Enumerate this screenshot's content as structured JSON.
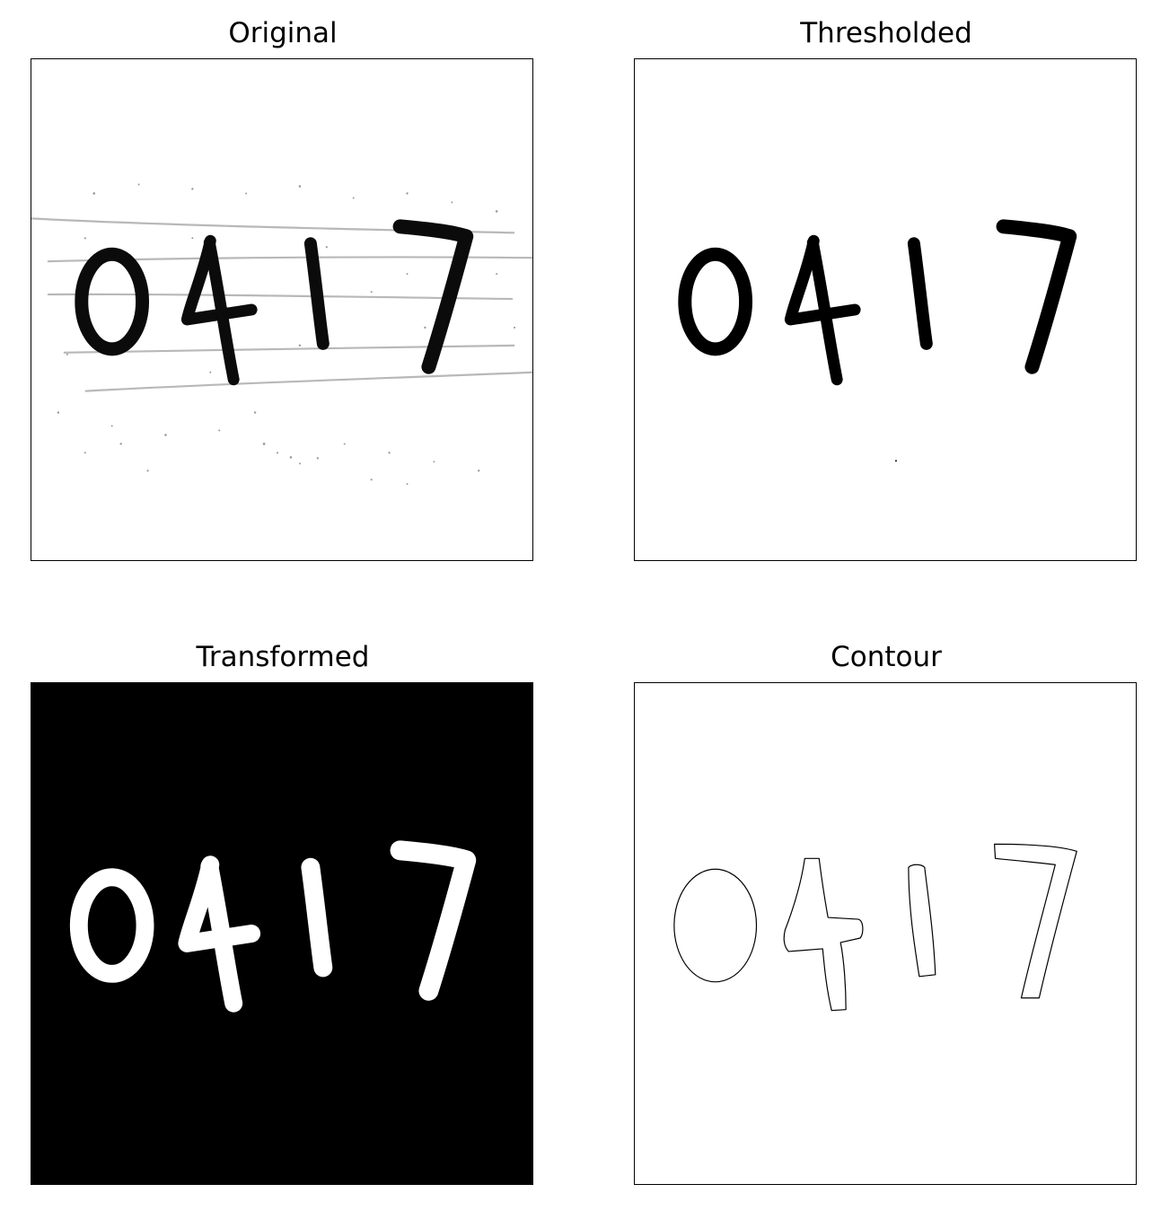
{
  "figure": {
    "panels": [
      {
        "key": "original",
        "title": "Original"
      },
      {
        "key": "thresholded",
        "title": "Thresholded"
      },
      {
        "key": "transformed",
        "title": "Transformed"
      },
      {
        "key": "contour",
        "title": "Contour"
      }
    ]
  }
}
